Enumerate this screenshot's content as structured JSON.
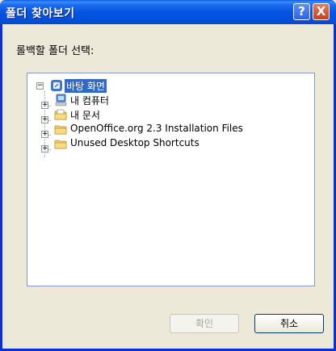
{
  "window": {
    "title": "폴더 찾아보기",
    "help_glyph": "?",
    "close_glyph": "X"
  },
  "prompt": "롤백할 폴더 선택:",
  "tree": {
    "root": {
      "label": "바탕 화면",
      "icon": "desktop-icon",
      "selected": true
    },
    "children": [
      {
        "label": "내 컴퓨터",
        "icon": "my-computer-icon"
      },
      {
        "label": "내 문서",
        "icon": "my-documents-icon"
      },
      {
        "label": "OpenOffice.org 2.3 Installation Files",
        "icon": "folder-icon"
      },
      {
        "label": "Unused Desktop Shortcuts",
        "icon": "folder-icon"
      }
    ]
  },
  "buttons": {
    "ok_label": "확인",
    "cancel_label": "취소"
  },
  "colors": {
    "titlebar": "#0454e2",
    "selection": "#316ac5",
    "folder": "#f2d06b"
  }
}
